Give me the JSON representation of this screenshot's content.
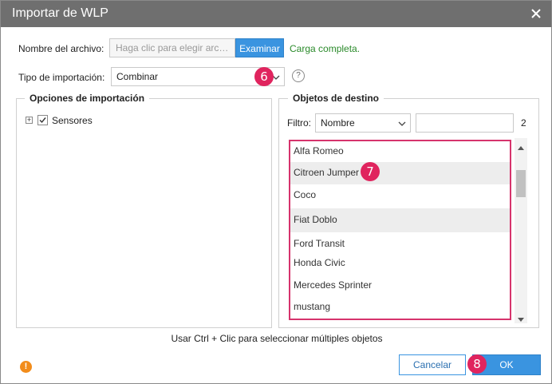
{
  "dialog": {
    "title": "Importar de WLP",
    "close_icon": "close-icon"
  },
  "file": {
    "label": "Nombre del archivo:",
    "placeholder": "Haga clic para elegir arc…",
    "browse_label": "Examinar",
    "status": "Carga completa."
  },
  "import_type": {
    "label": "Tipo de importación:",
    "value": "Combinar",
    "help": "?"
  },
  "markers": {
    "m6": "6",
    "m7": "7",
    "m8": "8"
  },
  "options": {
    "title": "Opciones de importación",
    "tree": [
      {
        "label": "Sensores",
        "expander": "+",
        "checked": true
      }
    ]
  },
  "targets": {
    "title": "Objetos de destino",
    "filter_label": "Filtro:",
    "filter_field": "Nombre",
    "filter_value": "",
    "count": "2",
    "items": [
      {
        "label": "Alfa Romeo",
        "selected": false
      },
      {
        "label": "Citroen Jumper",
        "selected": true
      },
      {
        "label": "Coco",
        "selected": false
      },
      {
        "label": "Fiat Doblo",
        "selected": true
      },
      {
        "label": "Ford Transit",
        "selected": false
      },
      {
        "label": "Honda Civic",
        "selected": false
      },
      {
        "label": "Mercedes Sprinter",
        "selected": false
      },
      {
        "label": "mustang",
        "selected": false
      }
    ]
  },
  "hint": "Usar Ctrl + Clic para seleccionar múltiples objetos",
  "buttons": {
    "cancel": "Cancelar",
    "ok": "OK"
  },
  "warning_icon": "!",
  "colors": {
    "titlebar": "#6f6f6f",
    "accent": "#3a94e0",
    "marker": "#e0245e",
    "success": "#2a8a2a",
    "warning": "#f28c1b"
  }
}
